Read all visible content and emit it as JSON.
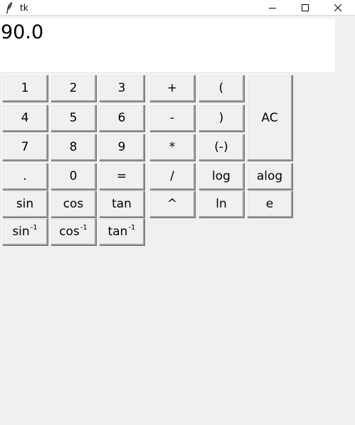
{
  "window": {
    "title": "tk"
  },
  "display": {
    "value": "90.0"
  },
  "buttons": {
    "b1": "1",
    "b2": "2",
    "b3": "3",
    "plus": "+",
    "lparen": "(",
    "b4": "4",
    "b5": "5",
    "b6": "6",
    "minus": "-",
    "rparen": ")",
    "b7": "7",
    "b8": "8",
    "b9": "9",
    "times": "*",
    "negate": "(-)",
    "ac": "AC",
    "dot": ".",
    "b0": "0",
    "equals": "=",
    "divide": "/",
    "log": "log",
    "alog": "alog",
    "sin": "sin",
    "cos": "cos",
    "tan": "tan",
    "power": "^",
    "ln": "ln",
    "e": "e",
    "asin_base": "sin",
    "acos_base": "cos",
    "atan_base": "tan",
    "inverse_sup": "-1"
  },
  "icons": {
    "app": "feather-icon",
    "minimize": "minimize-icon",
    "maximize": "maximize-icon",
    "close": "close-icon"
  }
}
